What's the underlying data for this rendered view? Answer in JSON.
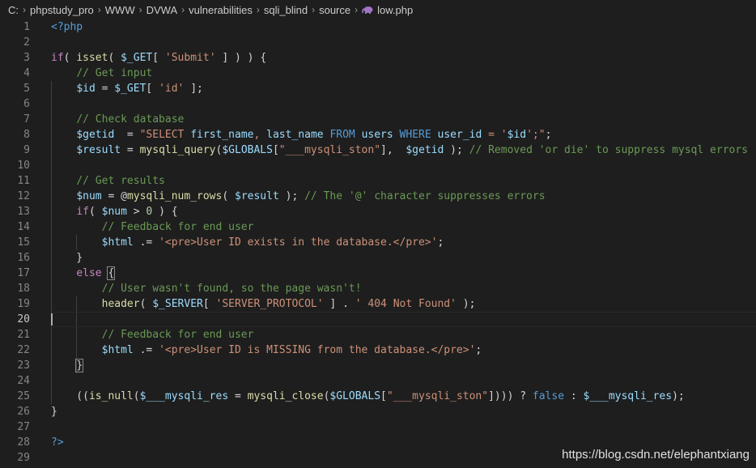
{
  "breadcrumb": {
    "parts": [
      "C:",
      "phpstudy_pro",
      "WWW",
      "DVWA",
      "vulnerabilities",
      "sqli_blind",
      "source"
    ],
    "file": "low.php",
    "separator": "›",
    "file_icon": "php-elephant-icon"
  },
  "editor": {
    "current_line": 20,
    "line_numbers": [
      "1",
      "2",
      "3",
      "4",
      "5",
      "6",
      "7",
      "8",
      "9",
      "10",
      "11",
      "12",
      "13",
      "14",
      "15",
      "16",
      "17",
      "18",
      "19",
      "20",
      "21",
      "22",
      "23",
      "24",
      "25",
      "26",
      "27",
      "28",
      "29"
    ],
    "lines": [
      [
        [
          "tag",
          "<?php"
        ]
      ],
      [],
      [
        [
          "kw",
          "if"
        ],
        [
          "op",
          "( "
        ],
        [
          "fn",
          "isset"
        ],
        [
          "op",
          "( "
        ],
        [
          "var",
          "$_GET"
        ],
        [
          "op",
          "[ "
        ],
        [
          "str",
          "'Submit'"
        ],
        [
          "op",
          " ] ) ) {"
        ]
      ],
      [
        [
          "op",
          "    "
        ],
        [
          "cm",
          "// Get input"
        ]
      ],
      [
        [
          "op",
          "    "
        ],
        [
          "var",
          "$id"
        ],
        [
          "op",
          " = "
        ],
        [
          "var",
          "$_GET"
        ],
        [
          "op",
          "[ "
        ],
        [
          "str",
          "'id'"
        ],
        [
          "op",
          " ];"
        ]
      ],
      [],
      [
        [
          "op",
          "    "
        ],
        [
          "cm",
          "// Check database"
        ]
      ],
      [
        [
          "op",
          "    "
        ],
        [
          "var",
          "$getid"
        ],
        [
          "op",
          "  = "
        ],
        [
          "str",
          "\"SELECT "
        ],
        [
          "var",
          "first_name"
        ],
        [
          "str",
          ", "
        ],
        [
          "var",
          "last_name"
        ],
        [
          "str",
          " "
        ],
        [
          "tag",
          "FROM"
        ],
        [
          "str",
          " "
        ],
        [
          "var",
          "users"
        ],
        [
          "str",
          " "
        ],
        [
          "tag",
          "WHERE"
        ],
        [
          "str",
          " "
        ],
        [
          "var",
          "user_id"
        ],
        [
          "str",
          " = '"
        ],
        [
          "var",
          "$id"
        ],
        [
          "str",
          "';\""
        ],
        [
          "op",
          ";"
        ]
      ],
      [
        [
          "op",
          "    "
        ],
        [
          "var",
          "$result"
        ],
        [
          "op",
          " = "
        ],
        [
          "fn",
          "mysqli_query"
        ],
        [
          "op",
          "("
        ],
        [
          "var",
          "$GLOBALS"
        ],
        [
          "op",
          "["
        ],
        [
          "str",
          "\"___mysqli_ston\""
        ],
        [
          "op",
          "],  "
        ],
        [
          "var",
          "$getid"
        ],
        [
          "op",
          " ); "
        ],
        [
          "cm",
          "// Removed 'or die' to suppress mysql errors"
        ]
      ],
      [],
      [
        [
          "op",
          "    "
        ],
        [
          "cm",
          "// Get results"
        ]
      ],
      [
        [
          "op",
          "    "
        ],
        [
          "var",
          "$num"
        ],
        [
          "op",
          " = @"
        ],
        [
          "fn",
          "mysqli_num_rows"
        ],
        [
          "op",
          "( "
        ],
        [
          "var",
          "$result"
        ],
        [
          "op",
          " ); "
        ],
        [
          "cm",
          "// The '@' character suppresses errors"
        ]
      ],
      [
        [
          "op",
          "    "
        ],
        [
          "kw",
          "if"
        ],
        [
          "op",
          "( "
        ],
        [
          "var",
          "$num"
        ],
        [
          "op",
          " > "
        ],
        [
          "num",
          "0"
        ],
        [
          "op",
          " ) {"
        ]
      ],
      [
        [
          "op",
          "        "
        ],
        [
          "cm",
          "// Feedback for end user"
        ]
      ],
      [
        [
          "op",
          "        "
        ],
        [
          "var",
          "$html"
        ],
        [
          "op",
          " .= "
        ],
        [
          "str",
          "'<pre>User ID exists in the database.</pre>'"
        ],
        [
          "op",
          ";"
        ]
      ],
      [
        [
          "op",
          "    }"
        ]
      ],
      [
        [
          "op",
          "    "
        ],
        [
          "kw",
          "else"
        ],
        [
          "op",
          " "
        ],
        [
          "brk",
          "{"
        ]
      ],
      [
        [
          "op",
          "        "
        ],
        [
          "cm",
          "// User wasn't found, so the page wasn't!"
        ]
      ],
      [
        [
          "op",
          "        "
        ],
        [
          "fn",
          "header"
        ],
        [
          "op",
          "( "
        ],
        [
          "var",
          "$_SERVER"
        ],
        [
          "op",
          "[ "
        ],
        [
          "str",
          "'SERVER_PROTOCOL'"
        ],
        [
          "op",
          " ] . "
        ],
        [
          "str",
          "' 404 Not Found'"
        ],
        [
          "op",
          " );"
        ]
      ],
      [],
      [
        [
          "op",
          "        "
        ],
        [
          "cm",
          "// Feedback for end user"
        ]
      ],
      [
        [
          "op",
          "        "
        ],
        [
          "var",
          "$html"
        ],
        [
          "op",
          " .= "
        ],
        [
          "str",
          "'<pre>User ID is MISSING from the database.</pre>'"
        ],
        [
          "op",
          ";"
        ]
      ],
      [
        [
          "op",
          "    "
        ],
        [
          "brk",
          "}"
        ]
      ],
      [],
      [
        [
          "op",
          "    (("
        ],
        [
          "fn",
          "is_null"
        ],
        [
          "op",
          "("
        ],
        [
          "var",
          "$___mysqli_res"
        ],
        [
          "op",
          " = "
        ],
        [
          "fn",
          "mysqli_close"
        ],
        [
          "op",
          "("
        ],
        [
          "var",
          "$GLOBALS"
        ],
        [
          "op",
          "["
        ],
        [
          "str",
          "\"___mysqli_ston\""
        ],
        [
          "op",
          "]))) ? "
        ],
        [
          "tag",
          "false"
        ],
        [
          "op",
          " : "
        ],
        [
          "var",
          "$___mysqli_res"
        ],
        [
          "op",
          ");"
        ]
      ],
      [
        [
          "op",
          "}"
        ]
      ],
      [],
      [
        [
          "tag",
          "?>"
        ]
      ],
      []
    ]
  },
  "watermark": "https://blog.csdn.net/elephantxiang",
  "colors": {
    "background": "#1e1e1e",
    "keyword": "#c586c0",
    "function": "#dcdcaa",
    "variable": "#9cdcfe",
    "string": "#ce9178",
    "comment": "#6a9955",
    "tag": "#569cd6"
  }
}
